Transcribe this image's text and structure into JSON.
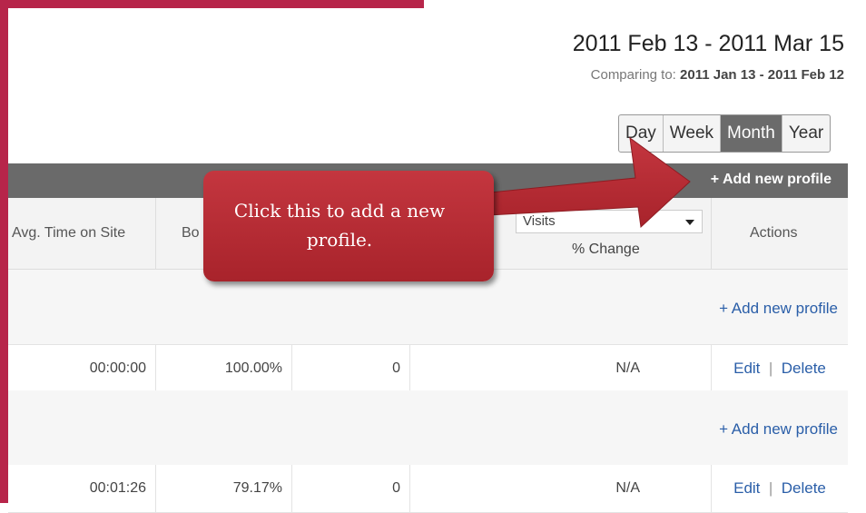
{
  "header": {
    "date_range": "2011 Feb 13 - 2011 Mar 15",
    "compare_label": "Comparing to:",
    "compare_range": "2011 Jan 13 - 2011 Feb 12"
  },
  "period_buttons": [
    {
      "label": "Day",
      "active": false
    },
    {
      "label": "Week",
      "active": false
    },
    {
      "label": "Month",
      "active": true
    },
    {
      "label": "Year",
      "active": false
    }
  ],
  "table": {
    "header_add_label": "+ Add new profile",
    "columns": {
      "avg_time": "Avg. Time on Site",
      "bounce": "Bo",
      "metric_select": "Visits",
      "pct_change": "% Change",
      "actions": "Actions"
    },
    "group_add_label": "+ Add new profile",
    "rows": [
      {
        "avg_time": "00:00:00",
        "bounce": "100.00%",
        "value": "0",
        "change": "N/A",
        "edit": "Edit",
        "sep": "|",
        "delete": "Delete"
      },
      {
        "avg_time": "00:01:26",
        "bounce": "79.17%",
        "value": "0",
        "change": "N/A",
        "edit": "Edit",
        "sep": "|",
        "delete": "Delete"
      }
    ]
  },
  "callout": {
    "text": "Click this to add a new profile."
  },
  "colors": {
    "accent_border": "#b7254a",
    "callout": "#b52c35",
    "header_bar": "#6a6a6a",
    "link": "#2a5ea8"
  }
}
